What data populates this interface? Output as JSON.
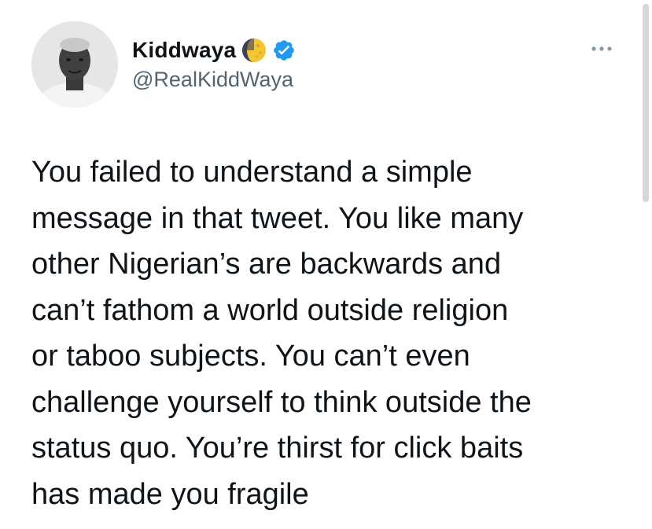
{
  "author": {
    "display_name": "Kiddwaya",
    "handle": "@RealKiddWaya",
    "avatar_icon": "avatar",
    "moon_icon": "crescent-moon-icon",
    "verified_icon": "verified-badge-icon",
    "verified_color": "#1d9bf0"
  },
  "tweet": {
    "text": "You failed to understand a simple\nmessage in that tweet. You like many\nother Nigerian’s are backwards and\ncan’t fathom a world outside religion\nor taboo subjects. You can’t even\nchallenge yourself to think outside the\nstatus quo. You’re thirst for click baits\nhas made you fragile"
  },
  "actions": {
    "more_icon": "more-options-icon"
  }
}
